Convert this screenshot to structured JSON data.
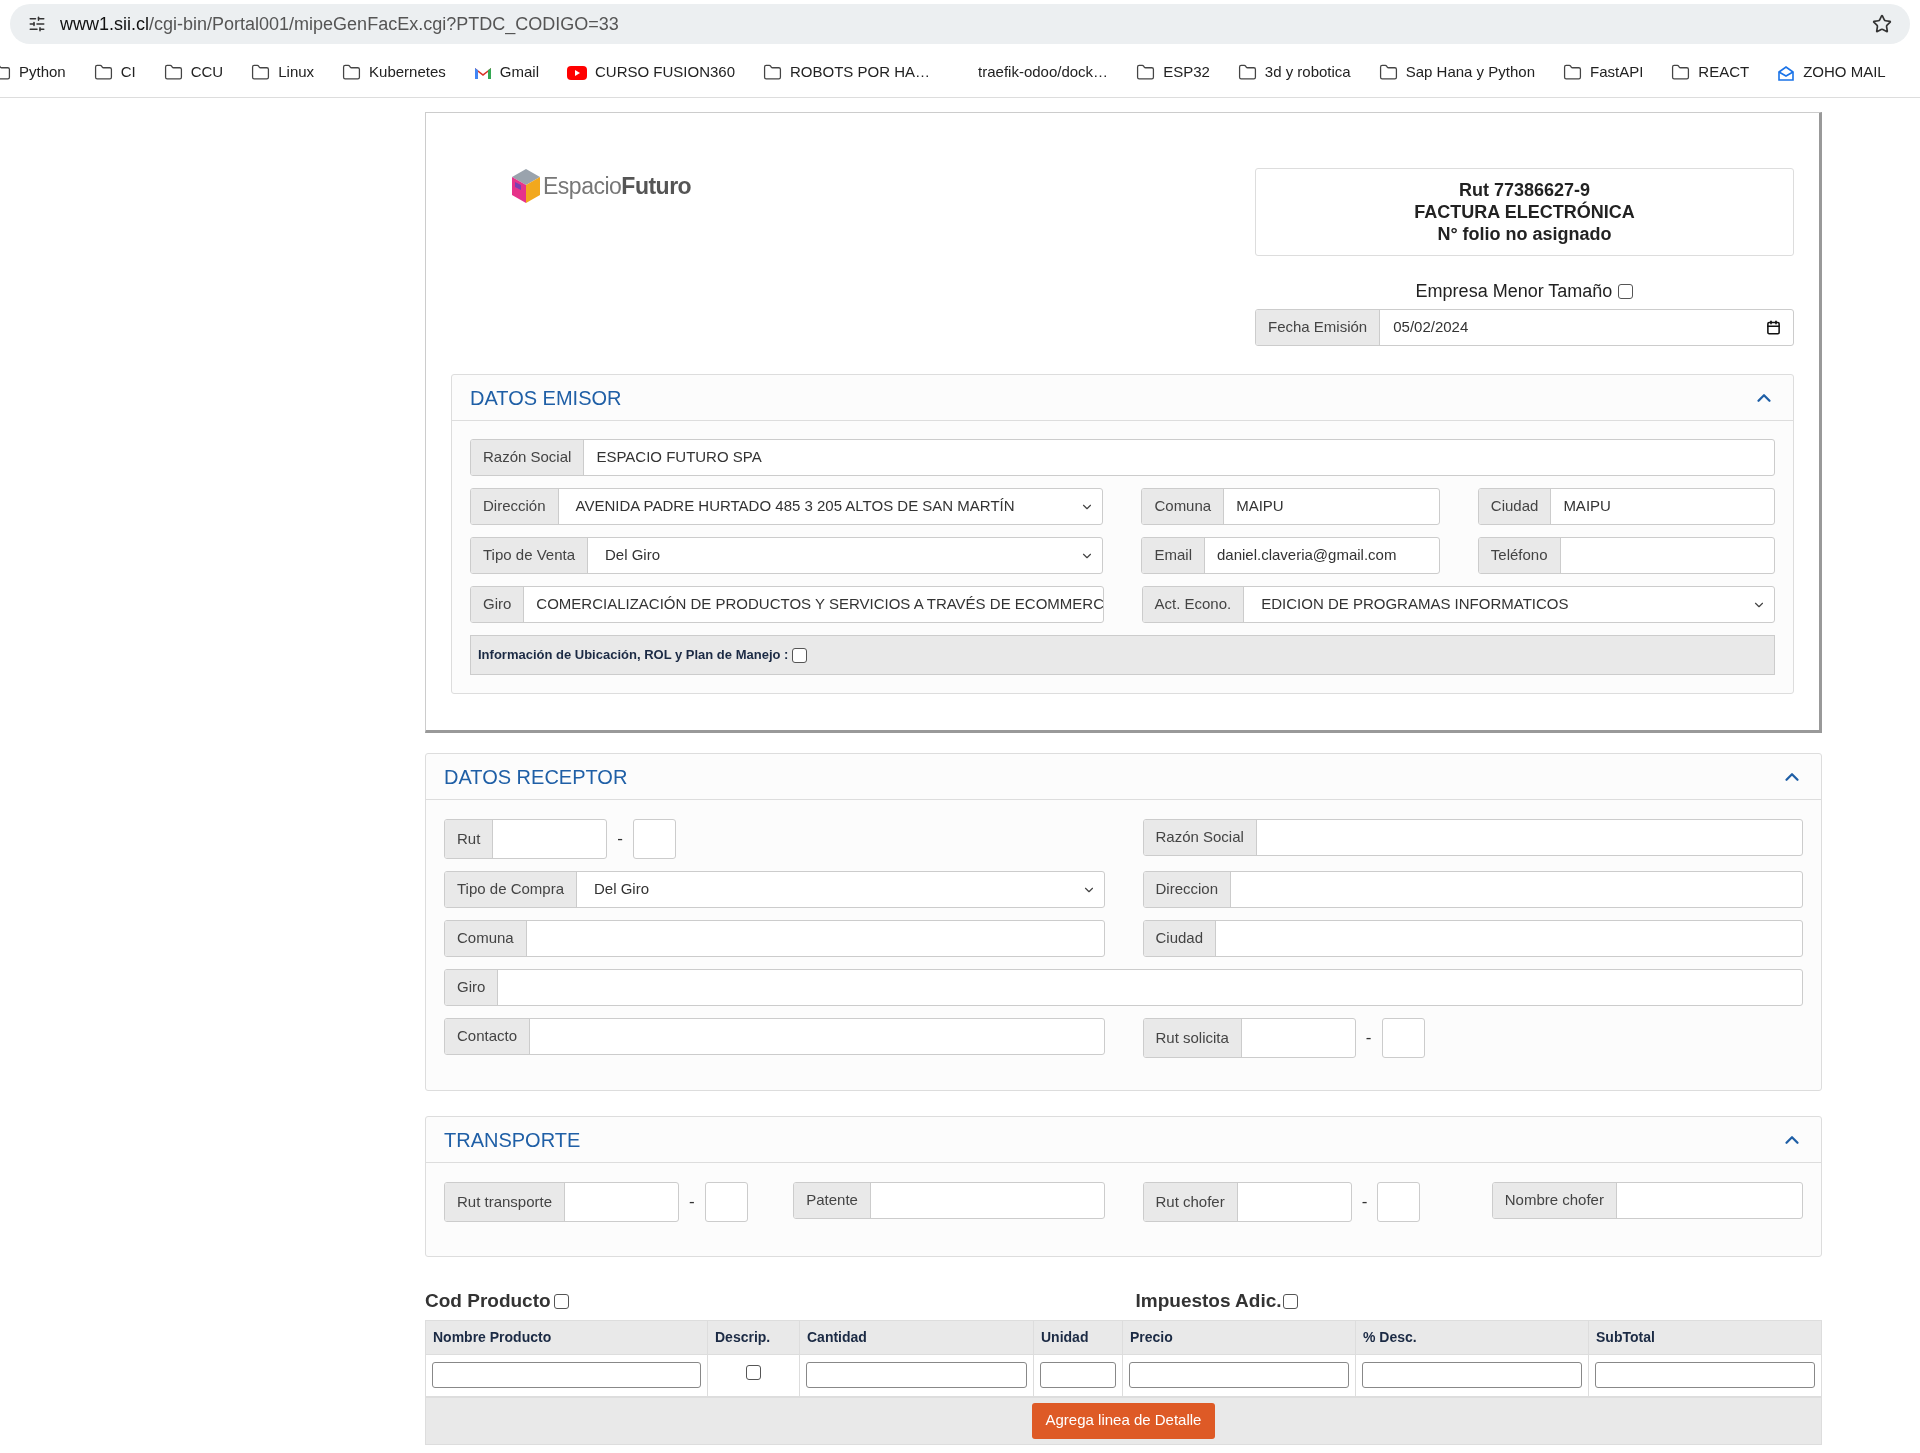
{
  "browser": {
    "url_host": "www1.sii.cl",
    "url_path": "/cgi-bin/Portal001/mipeGenFacEx.cgi?PTDC_CODIGO=33",
    "bookmarks": [
      {
        "kind": "folder",
        "label": "Python"
      },
      {
        "kind": "folder",
        "label": "CI"
      },
      {
        "kind": "folder",
        "label": "CCU"
      },
      {
        "kind": "folder",
        "label": "Linux"
      },
      {
        "kind": "folder",
        "label": "Kubernetes"
      },
      {
        "kind": "gmail",
        "label": "Gmail"
      },
      {
        "kind": "youtube",
        "label": "CURSO FUSION360"
      },
      {
        "kind": "folder",
        "label": "ROBOTS POR HA…"
      },
      {
        "kind": "blank",
        "label": "traefik-odoo/dock…"
      },
      {
        "kind": "folder",
        "label": "ESP32"
      },
      {
        "kind": "folder",
        "label": "3d y robotica"
      },
      {
        "kind": "folder",
        "label": "Sap Hana y Python"
      },
      {
        "kind": "folder",
        "label": "FastAPI"
      },
      {
        "kind": "folder",
        "label": "REACT"
      },
      {
        "kind": "zoho",
        "label": "ZOHO MAIL"
      }
    ]
  },
  "header": {
    "logo_light": "Espacio",
    "logo_bold": "Futuro",
    "doc_lines": [
      "Rut 77386627-9",
      "FACTURA ELECTRÓNICA",
      "N° folio no asignado"
    ],
    "empresa_menor": {
      "label": "Empresa Menor Tamaño",
      "checked": false
    },
    "fecha": {
      "label": "Fecha Emisión",
      "value": "05/02/2024"
    }
  },
  "emisor": {
    "title": "DATOS EMISOR",
    "expanded": true,
    "rows": [
      [
        {
          "kind": "text",
          "label": "Razón Social",
          "value": "ESPACIO FUTURO SPA"
        }
      ],
      [
        {
          "kind": "select",
          "label": "Dirección",
          "value": "AVENIDA PADRE HURTADO 485 3 205 ALTOS DE SAN MARTÍN"
        },
        {
          "kind": "text",
          "label": "Comuna",
          "value": "MAIPU"
        },
        {
          "kind": "text",
          "label": "Ciudad",
          "value": "MAIPU"
        }
      ],
      [
        {
          "kind": "select",
          "label": "Tipo de Venta",
          "value": "Del Giro"
        },
        {
          "kind": "text",
          "label": "Email",
          "value": "daniel.claveria@gmail.com"
        },
        {
          "kind": "text",
          "label": "Teléfono"
        }
      ],
      [
        {
          "kind": "text",
          "label": "Giro",
          "value": "COMERCIALIZACIÓN DE PRODUCTOS Y SERVICIOS A TRAVÉS DE ECOMMERC"
        },
        {
          "kind": "select",
          "label": "Act. Econo.",
          "value": "EDICION DE PROGRAMAS INFORMATICOS"
        }
      ]
    ],
    "ubicacion": {
      "label": "Información de Ubicación, ROL y Plan de Manejo :",
      "checked": false
    }
  },
  "receptor": {
    "title": "DATOS RECEPTOR",
    "expanded": true,
    "rows": [
      [
        {
          "kind": "rut",
          "label": "Rut",
          "separator": "-"
        },
        {
          "kind": "text",
          "label": "Razón Social"
        }
      ],
      [
        {
          "kind": "select",
          "label": "Tipo de Compra",
          "value": "Del Giro"
        },
        {
          "kind": "text",
          "label": "Direccion"
        }
      ],
      [
        {
          "kind": "text",
          "label": "Comuna"
        },
        {
          "kind": "text",
          "label": "Ciudad"
        }
      ],
      [
        {
          "kind": "text",
          "label": "Giro"
        }
      ],
      [
        {
          "kind": "text",
          "label": "Contacto"
        },
        {
          "kind": "rut",
          "label": "Rut solicita",
          "separator": "-"
        }
      ]
    ]
  },
  "transporte": {
    "title": "TRANSPORTE",
    "expanded": true,
    "rows": [
      [
        {
          "kind": "rut",
          "label": "Rut transporte",
          "separator": "-"
        },
        {
          "kind": "text",
          "label": "Patente"
        },
        {
          "kind": "rut",
          "label": "Rut chofer",
          "separator": "-"
        },
        {
          "kind": "text",
          "label": "Nombre chofer"
        }
      ]
    ]
  },
  "detalle": {
    "cod_producto": {
      "label": "Cod Producto",
      "checked": false
    },
    "impuestos": {
      "label": "Impuestos Adic.",
      "checked": false
    },
    "columns": [
      "Nombre Producto",
      "Descrip.",
      "Cantidad",
      "Unidad",
      "Precio",
      "% Desc.",
      "SubTotal"
    ],
    "row": [
      {
        "kind": "input"
      },
      {
        "kind": "checkbox",
        "checked": false
      },
      {
        "kind": "input"
      },
      {
        "kind": "input"
      },
      {
        "kind": "input"
      },
      {
        "kind": "input"
      },
      {
        "kind": "input"
      }
    ],
    "add_button": "Agrega linea de Detalle"
  }
}
